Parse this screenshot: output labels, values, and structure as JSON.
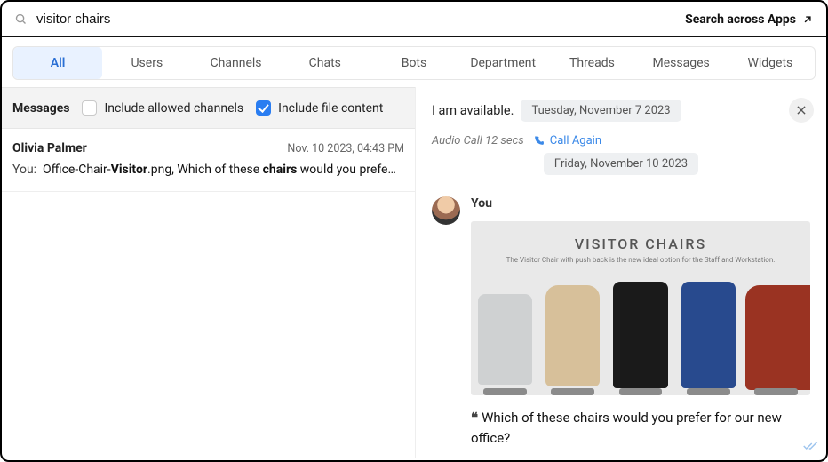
{
  "search": {
    "query": "visitor chairs",
    "across_label": "Search across Apps"
  },
  "tabs": [
    "All",
    "Users",
    "Channels",
    "Chats",
    "Bots",
    "Department",
    "Threads",
    "Messages",
    "Widgets"
  ],
  "left": {
    "section_label": "Messages",
    "include_allowed_label": "Include allowed channels",
    "include_allowed_checked": false,
    "include_file_label": "Include file content",
    "include_file_checked": true,
    "result": {
      "name": "Olivia Palmer",
      "timestamp": "Nov. 10 2023, 04:43 PM",
      "you_prefix": "You:",
      "snippet_a": "Office-Chair-",
      "snippet_b_bold": "Visitor",
      "snippet_c": ".png, Which of these ",
      "snippet_d_bold": "chairs",
      "snippet_e": " would you prefe…"
    }
  },
  "right": {
    "line_available": "I am available.",
    "date1": "Tuesday, November 7 2023",
    "call_label": "Audio Call  12 secs",
    "call_again": "Call Again",
    "date2": "Friday, November 10 2023",
    "sender": "You",
    "image_title": "VISITOR CHAIRS",
    "image_sub": "The Visitor Chair with push back is the new ideal option for the Staff and Workstation.",
    "question": "Which of these chairs would you prefer for our new office?"
  }
}
